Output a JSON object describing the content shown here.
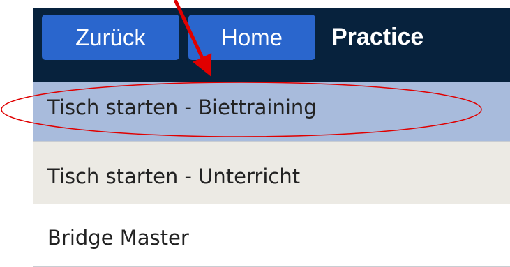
{
  "header": {
    "back_label": "Zurück",
    "home_label": "Home",
    "title": "Practice",
    "background": "#07223d",
    "button_color": "#2a66cd"
  },
  "menu": {
    "items": [
      {
        "label": "Tisch starten - Biettraining",
        "highlighted": true
      },
      {
        "label": "Tisch starten - Unterricht",
        "highlighted": false
      },
      {
        "label": "Bridge Master",
        "highlighted": false
      }
    ],
    "highlight_color": "#a8bbdc"
  },
  "annotation": {
    "color": "#e00000",
    "shapes": [
      "arrow",
      "ellipse"
    ]
  }
}
